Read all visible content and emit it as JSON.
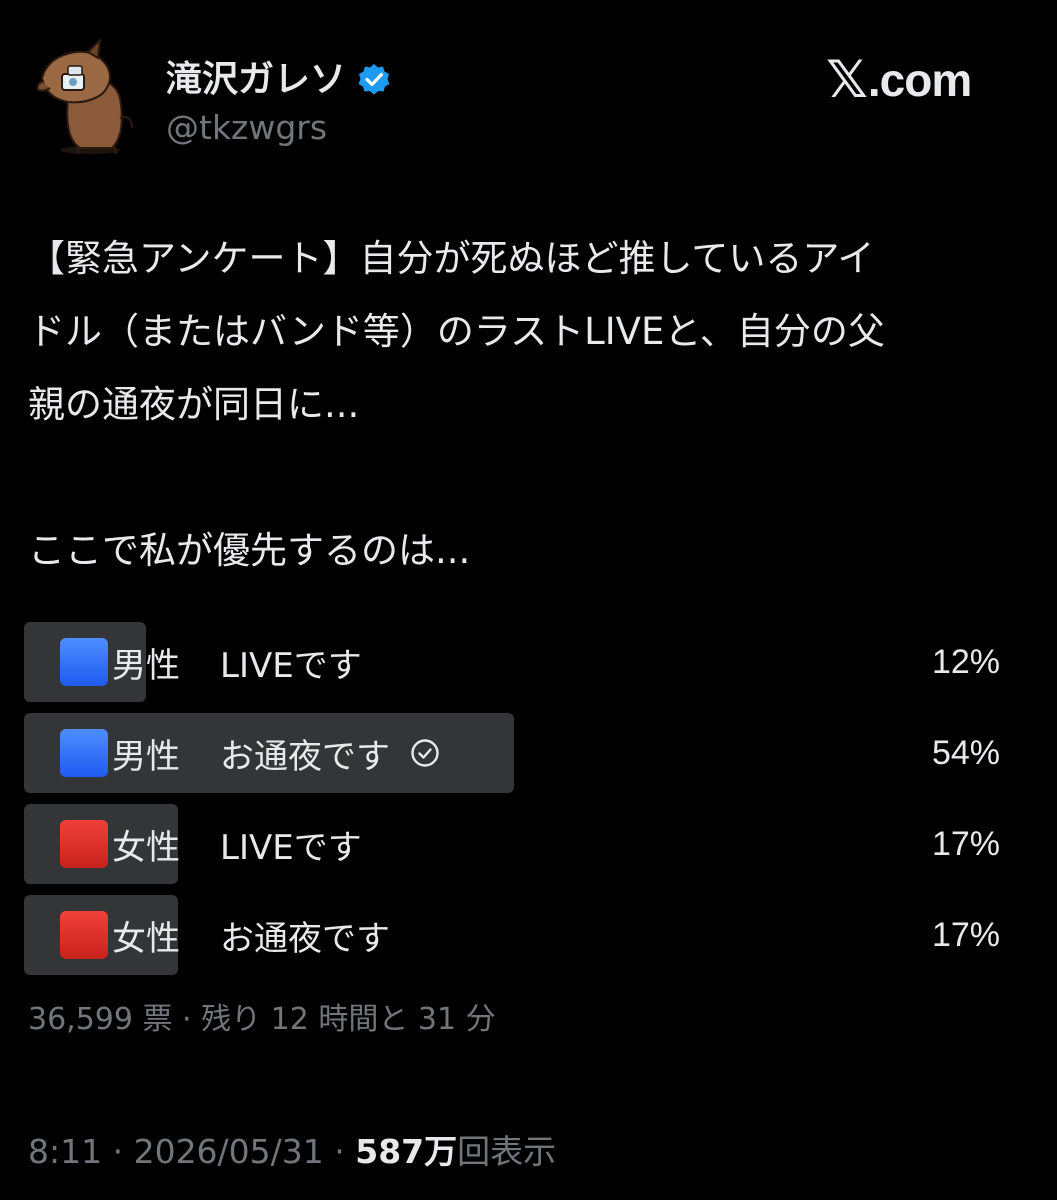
{
  "author": {
    "display_name": "滝沢ガレソ",
    "handle": "@tkzwgrs",
    "verified_icon": "verified-badge-icon",
    "avatar": "cartoon-character-avatar"
  },
  "site_logo": {
    "mark": "𝕏",
    "suffix": ".com"
  },
  "tweet": {
    "paragraph1": "【緊急アンケート】自分が死ぬほど推しているアイ\nドル（またはバンド等）のラストLIVEと、自分の父\n親の通夜が同日に...",
    "paragraph2": "ここで私が優先するのは..."
  },
  "poll": {
    "options": [
      {
        "gender": "男性",
        "choice": "LIVEです",
        "percent_label": "12%",
        "percent": 12,
        "color": "blue",
        "voted": false
      },
      {
        "gender": "男性",
        "choice": "お通夜です",
        "percent_label": "54%",
        "percent": 54,
        "color": "blue",
        "voted": true
      },
      {
        "gender": "女性",
        "choice": "LIVEです",
        "percent_label": "17%",
        "percent": 17,
        "color": "red",
        "voted": false
      },
      {
        "gender": "女性",
        "choice": "お通夜です",
        "percent_label": "17%",
        "percent": 17,
        "color": "red",
        "voted": false
      }
    ],
    "meta": "36,599 票 · 残り 12 時間と 31 分",
    "colors": {
      "fill": "#343537",
      "blue": "#2d6cf6",
      "red": "#e0302a"
    }
  },
  "footer": {
    "time_date": "8:11 · 2026/05/31 · ",
    "views_count": "587万",
    "views_label": "回表示"
  }
}
